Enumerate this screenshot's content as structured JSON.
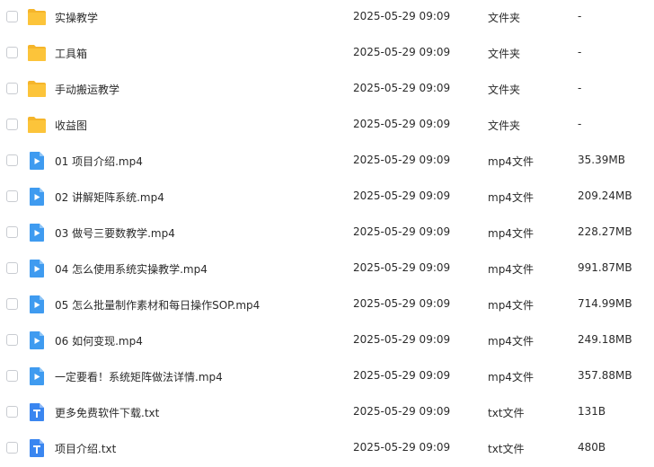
{
  "files": [
    {
      "name": "实操教学",
      "date": "2025-05-29 09:09",
      "type": "文件夹",
      "size": "-",
      "icon": "folder-icon"
    },
    {
      "name": "工具箱",
      "date": "2025-05-29 09:09",
      "type": "文件夹",
      "size": "-",
      "icon": "folder-icon"
    },
    {
      "name": "手动搬运教学",
      "date": "2025-05-29 09:09",
      "type": "文件夹",
      "size": "-",
      "icon": "folder-icon"
    },
    {
      "name": "收益图",
      "date": "2025-05-29 09:09",
      "type": "文件夹",
      "size": "-",
      "icon": "folder-icon"
    },
    {
      "name": "01 项目介绍.mp4",
      "date": "2025-05-29 09:09",
      "type": "mp4文件",
      "size": "35.39MB",
      "icon": "video-file-icon"
    },
    {
      "name": "02 讲解矩阵系统.mp4",
      "date": "2025-05-29 09:09",
      "type": "mp4文件",
      "size": "209.24MB",
      "icon": "video-file-icon"
    },
    {
      "name": "03 做号三要数教学.mp4",
      "date": "2025-05-29 09:09",
      "type": "mp4文件",
      "size": "228.27MB",
      "icon": "video-file-icon"
    },
    {
      "name": "04 怎么使用系统实操教学.mp4",
      "date": "2025-05-29 09:09",
      "type": "mp4文件",
      "size": "991.87MB",
      "icon": "video-file-icon"
    },
    {
      "name": "05 怎么批量制作素材和每日操作SOP.mp4",
      "date": "2025-05-29 09:09",
      "type": "mp4文件",
      "size": "714.99MB",
      "icon": "video-file-icon"
    },
    {
      "name": "06 如何变现.mp4",
      "date": "2025-05-29 09:09",
      "type": "mp4文件",
      "size": "249.18MB",
      "icon": "video-file-icon"
    },
    {
      "name": "一定要看！系统矩阵做法详情.mp4",
      "date": "2025-05-29 09:09",
      "type": "mp4文件",
      "size": "357.88MB",
      "icon": "video-file-icon"
    },
    {
      "name": "更多免费软件下载.txt",
      "date": "2025-05-29 09:09",
      "type": "txt文件",
      "size": "131B",
      "icon": "text-file-icon"
    },
    {
      "name": "项目介绍.txt",
      "date": "2025-05-29 09:09",
      "type": "txt文件",
      "size": "480B",
      "icon": "text-file-icon"
    }
  ],
  "colors": {
    "folder": "#fcc43a",
    "folder_back": "#f5b52a",
    "video": "#3f9bf0",
    "text": "#3a86f0"
  }
}
